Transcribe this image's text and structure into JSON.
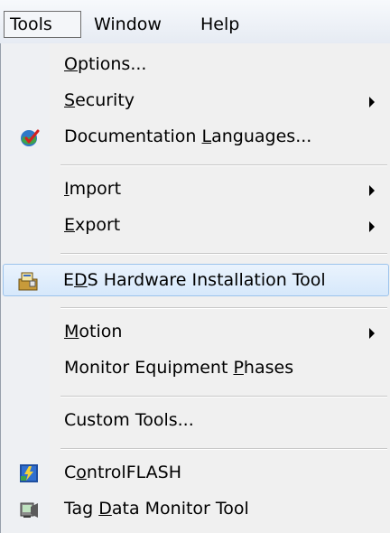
{
  "menubar": {
    "tools": "Tools",
    "window": "Window",
    "help": "Help"
  },
  "menu": {
    "items": [
      {
        "label": "Options...",
        "mnemonic": "O"
      },
      {
        "label": "Security",
        "mnemonic": "S",
        "submenu": true
      },
      {
        "label": "Documentation Languages...",
        "mnemonic": "L",
        "icon": "globe-check-icon"
      },
      {
        "label": "Import",
        "mnemonic": "I",
        "submenu": true
      },
      {
        "label": "Export",
        "mnemonic": "E",
        "submenu": true
      },
      {
        "label": "EDS Hardware Installation Tool",
        "mnemonic": "D",
        "icon": "hardware-install-icon",
        "highlighted": true
      },
      {
        "label": "Motion",
        "mnemonic": "M",
        "submenu": true
      },
      {
        "label": "Monitor Equipment Phases",
        "mnemonic": "P"
      },
      {
        "label": "Custom Tools...",
        "mnemonic": ""
      },
      {
        "label": "ControlFLASH",
        "mnemonic": "o",
        "icon": "controlflash-icon"
      },
      {
        "label": "Tag Data Monitor Tool",
        "mnemonic": "D",
        "icon": "tag-monitor-icon"
      }
    ]
  },
  "colors": {
    "highlight_fill": "#d6e8fb",
    "highlight_border": "#9cc3ec",
    "menu_background": "#f0f0f0"
  }
}
